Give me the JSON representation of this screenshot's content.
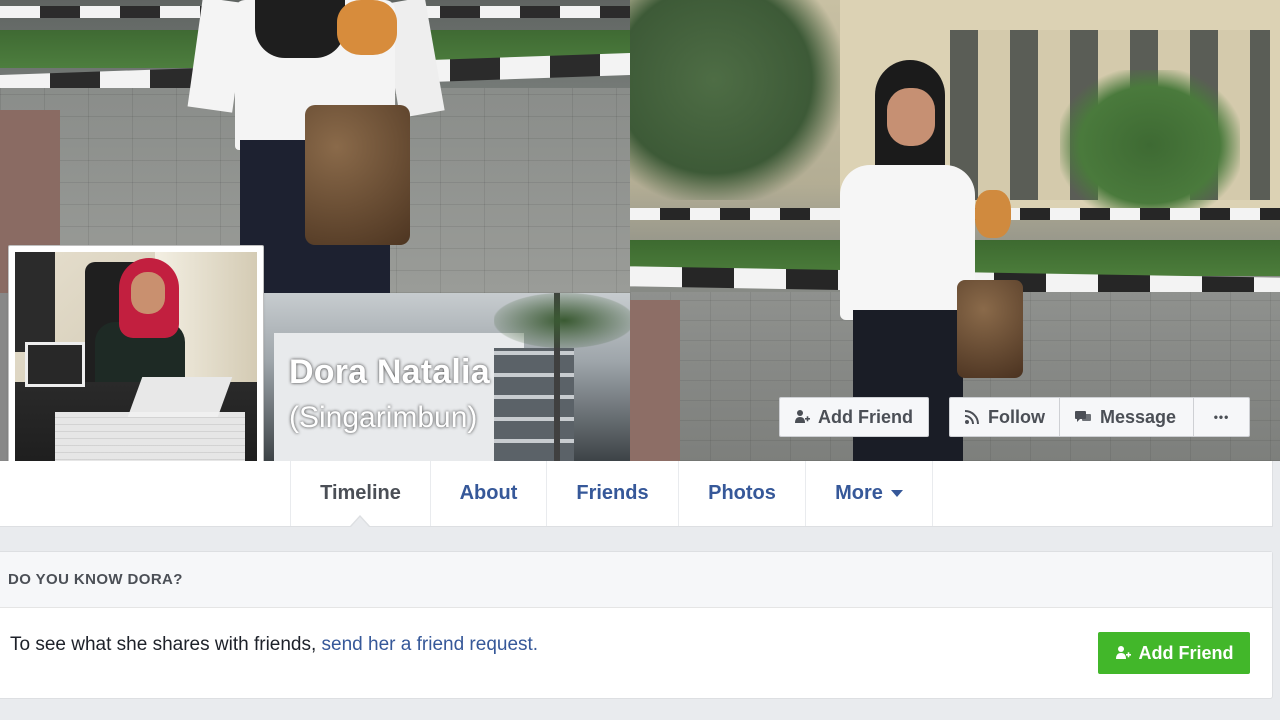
{
  "profile": {
    "name": "Dora Natalia",
    "alternate_name": "(Singarimbun)"
  },
  "actions": {
    "add_friend": "Add Friend",
    "follow": "Follow",
    "message": "Message",
    "more_symbol": "•••"
  },
  "tabs": [
    {
      "label": "Timeline",
      "active": true
    },
    {
      "label": "About",
      "active": false
    },
    {
      "label": "Friends",
      "active": false
    },
    {
      "label": "Photos",
      "active": false
    },
    {
      "label": "More",
      "active": false
    }
  ],
  "know_box": {
    "title": "DO YOU KNOW DORA?",
    "text_prefix": "To see what she shares with friends, ",
    "link_text": "send her a friend request.",
    "button_label": "Add Friend"
  },
  "icons": {
    "add_friend": "person-plus-icon",
    "follow": "rss-icon",
    "message": "chat-bubbles-icon",
    "more": "ellipsis-icon",
    "tab_more": "caret-down-icon"
  },
  "colors": {
    "link": "#365899",
    "green_button": "#42b72a",
    "text_dark": "#1d2129",
    "page_bg": "#e9ebee"
  }
}
